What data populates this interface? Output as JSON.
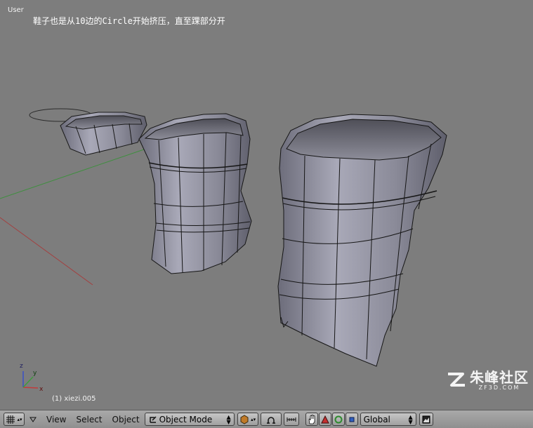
{
  "viewport": {
    "view_label": "User",
    "annotation": "鞋子也是从10边的Circle开始挤压，直至踝部分开",
    "object_info": "(1) xiezi.005"
  },
  "axes": {
    "x": "x",
    "y": "y",
    "z": "z"
  },
  "header": {
    "menus": {
      "view": "View",
      "select": "Select",
      "object": "Object"
    },
    "mode": "Object Mode",
    "orientation": "Global"
  },
  "watermark": {
    "brand": "朱峰社区",
    "domain": "ZF3D.COM"
  },
  "icons": {
    "editor_type": "grid-icon",
    "collapse": "triangle-down-icon",
    "mode": "object-mode-icon",
    "shading": "solid-shading-icon",
    "pivot": "pivot-icon",
    "snap": "snap-icon",
    "hand": "hand-icon",
    "translate": "translate-icon",
    "rotate": "rotate-icon",
    "scale": "scale-icon",
    "render": "render-icon"
  },
  "colors": {
    "viewport_bg": "#7d7d7d",
    "header_bg": "#9c9c9c",
    "axis_x": "#c33a3a",
    "axis_y": "#3e9a3e",
    "axis_z": "#3a50c8"
  }
}
